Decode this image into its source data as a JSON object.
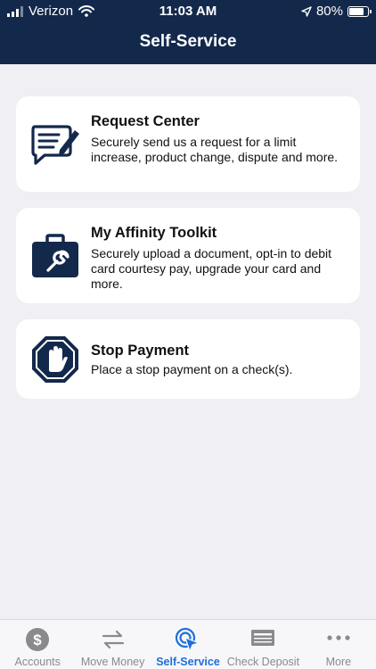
{
  "status_bar": {
    "carrier": "Verizon",
    "time": "11:03 AM",
    "battery": "80%",
    "battery_level": 0.8
  },
  "header": {
    "title": "Self-Service"
  },
  "cards": [
    {
      "title": "Request Center",
      "description": "Securely send us a request for a limit increase, product change, dispute and more.",
      "icon": "edit-document-icon"
    },
    {
      "title": "My Affinity Toolkit",
      "description": "Securely upload a document, opt-in to debit card courtesy pay, upgrade your card and more.",
      "icon": "toolbox-icon"
    },
    {
      "title": "Stop Payment",
      "description": "Place a stop payment on a check(s).",
      "icon": "stop-hand-icon"
    }
  ],
  "tabs": [
    {
      "label": "Accounts",
      "icon": "dollar-coin-icon",
      "active": false
    },
    {
      "label": "Move Money",
      "icon": "transfer-arrows-icon",
      "active": false
    },
    {
      "label": "Self-Service",
      "icon": "cursor-click-icon",
      "active": true
    },
    {
      "label": "Check Deposit",
      "icon": "check-icon",
      "active": false
    },
    {
      "label": "More",
      "icon": "more-dots-icon",
      "active": false
    }
  ],
  "colors": {
    "header_bg": "#13294b",
    "icon_navy": "#13294b",
    "active_tab": "#1d6fd9",
    "inactive_tab": "#8a8a8e"
  }
}
